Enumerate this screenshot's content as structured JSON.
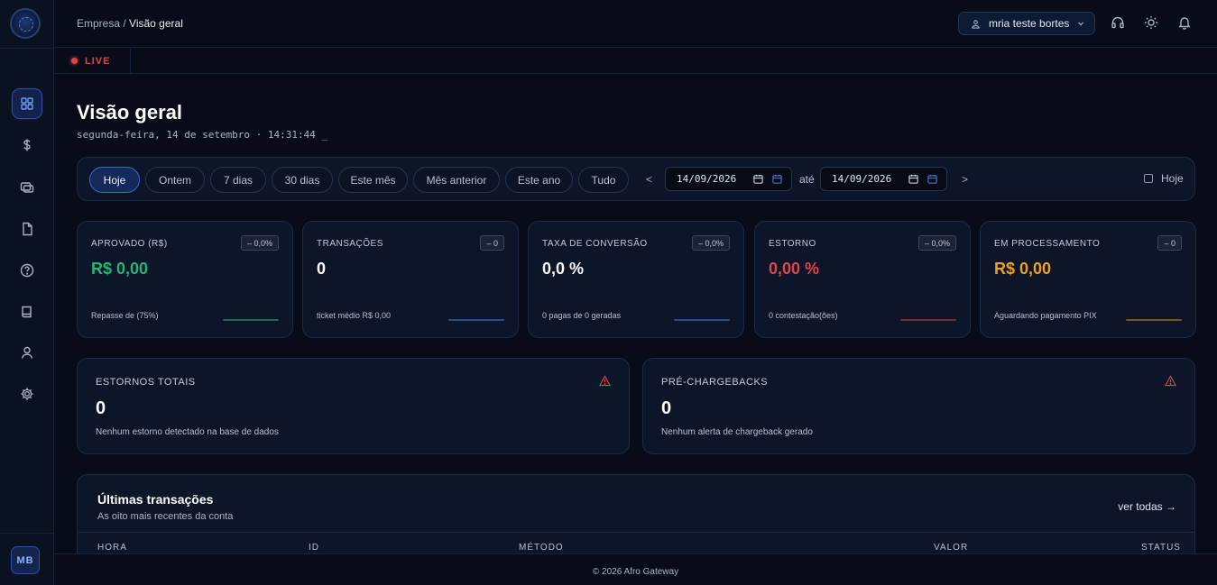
{
  "header": {
    "breadcrumb_parent": "Empresa",
    "breadcrumb_separator": " / ",
    "breadcrumb_current": "Visão geral",
    "user_name": "mria teste bortes"
  },
  "live_label": "LIVE",
  "sidebar": {
    "items": [
      {
        "icon": "dashboard-grid-icon",
        "active": true
      },
      {
        "icon": "dollar-icon"
      },
      {
        "icon": "cards-icon"
      },
      {
        "icon": "document-icon"
      },
      {
        "icon": "help-circle-icon"
      },
      {
        "icon": "book-icon"
      },
      {
        "icon": "user-icon"
      },
      {
        "icon": "gear-icon"
      }
    ],
    "avatar_initials": "MB"
  },
  "page": {
    "title": "Visão geral",
    "subtitle": "segunda-feira, 14 de setembro · 14:31:44 _"
  },
  "filters": {
    "chips": [
      "Hoje",
      "Ontem",
      "7 dias",
      "30 dias",
      "Este mês",
      "Mês anterior",
      "Este ano",
      "Tudo"
    ],
    "active_chip": "Hoje",
    "prev_arrow": "<",
    "next_arrow": ">",
    "date_from": "14/09/2026",
    "date_sep": "até",
    "date_to": "14/09/2026",
    "today_toggle": "Hoje"
  },
  "kpis": [
    {
      "label": "APROVADO (R$)",
      "badge": "– 0,0%",
      "value": "R$ 0,00",
      "foot": "Repasse de (75%)",
      "color": "#22b573",
      "spark": "#1f6b4d"
    },
    {
      "label": "TRANSAÇÕES",
      "badge": "– 0",
      "value": "0",
      "foot": "ticket médio R$ 0,00",
      "color": "#ffffff",
      "spark": "#2b4d8c"
    },
    {
      "label": "TAXA DE CONVERSÃO",
      "badge": "– 0,0%",
      "value": "0,0 %",
      "foot": "0 pagas de 0 geradas",
      "color": "#ffffff",
      "spark": "#2b4d8c"
    },
    {
      "label": "ESTORNO",
      "badge": "– 0,0%",
      "value": "0,00 %",
      "foot": "0 contestação(ões)",
      "color": "#e0454a",
      "spark": "#7a2c33"
    },
    {
      "label": "EM PROCESSAMENTO",
      "badge": "– 0",
      "value": "R$ 0,00",
      "foot": "Aguardando pagamento PIX",
      "color": "#f0a020",
      "spark": "#7a5520"
    }
  ],
  "alerts": [
    {
      "label": "ESTORNOS TOTAIS",
      "value": "0",
      "desc": "Nenhum estorno detectado na base de dados"
    },
    {
      "label": "PRÉ-CHARGEBACKS",
      "value": "0",
      "desc": "Nenhum alerta de chargeback gerado"
    }
  ],
  "transactions": {
    "title": "Últimas transações",
    "subtitle": "As oito mais recentes da conta",
    "link": "ver todas →",
    "columns": [
      "HORA",
      "ID",
      "MÉTODO",
      "VALOR",
      "STATUS"
    ]
  },
  "footer": {
    "copyright": "© 2026 Afro Gateway"
  }
}
